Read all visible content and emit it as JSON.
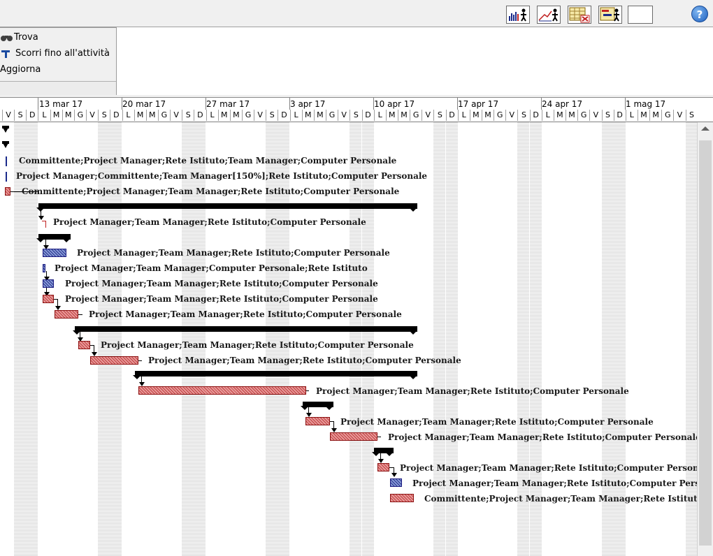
{
  "toolbar": {
    "help_label": "?",
    "buttons": [
      "resource-graph-icon",
      "resource-usage-icon",
      "task-usage-icon",
      "team-planner-icon",
      "blank-view-icon"
    ]
  },
  "menu": {
    "find_label": "Trova",
    "scroll_label": "Scorri fino all'attività",
    "refresh_label": "Aggiorna"
  },
  "timescale": {
    "weeks": [
      "13 mar 17",
      "20 mar 17",
      "27 mar 17",
      "3 apr 17",
      "10 apr 17",
      "17 apr 17",
      "24 apr 17",
      "1 mag 17"
    ],
    "first_days": [
      "V",
      "S",
      "D"
    ],
    "week_days": [
      "L",
      "M",
      "M",
      "G",
      "V",
      "S",
      "D"
    ]
  },
  "resources": {
    "r1": "Committente;Project Manager;Rete Istituto;Team Manager;Computer Personale",
    "r2": "Project Manager;Committente;Team Manager[150%];Rete Istituto;Computer Personale",
    "r3": "Committente;Project Manager;Team Manager;Rete Istituto;Computer Personale",
    "r4": "Project Manager;Team Manager;Rete Istituto;Computer Personale",
    "r5": "Project Manager;Team Manager;Rete Istituto;Computer Personale",
    "r6": "Project Manager;Team Manager;Computer Personale;Rete Istituto",
    "r7": "Project Manager;Team Manager;Rete Istituto;Computer Personale",
    "r8": "Project Manager;Team Manager;Rete Istituto;Computer Personale",
    "r9": "Project Manager;Team Manager;Rete Istituto;Computer Personale",
    "r10": "Project Manager;Team Manager;Rete Istituto;Computer Personale",
    "r11": "Project Manager;Team Manager;Rete Istituto;Computer Personale",
    "r12": "Project Manager;Team Manager;Rete Istituto;Computer Personale",
    "r13": "Project Manager;Team Manager;Rete Istituto;Computer Personale",
    "r14": "Project Manager;Team Manager;Rete Istituto;Computer Personale",
    "r15": "Project Manager;Team Manager;Rete Istituto;Computer Personale",
    "r16": "Project Manager;Team Manager;Rete Istituto;Computer Personale",
    "r17": "Committente;Project Manager;Team Manager;Rete Istituto;Computer Personale"
  },
  "colors": {
    "task_bar": "#e89a9a",
    "critical_bar": "#8a9ad8",
    "summary_bar": "#000000"
  }
}
